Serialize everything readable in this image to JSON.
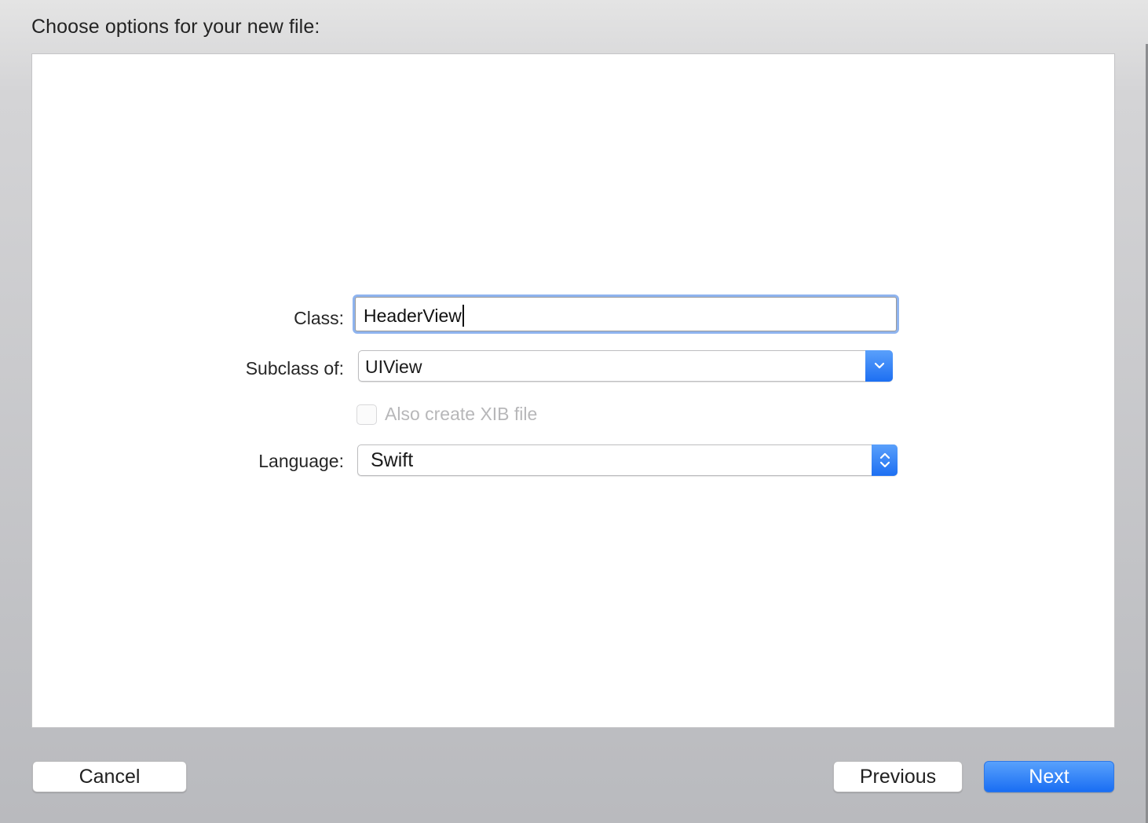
{
  "dialog": {
    "title": "Choose options for your new file:"
  },
  "form": {
    "class_label": "Class:",
    "class_value": "HeaderView",
    "subclass_label": "Subclass of:",
    "subclass_value": "UIView",
    "xib_checkbox_label": "Also create XIB file",
    "xib_checkbox_checked": false,
    "xib_checkbox_enabled": false,
    "language_label": "Language:",
    "language_value": "Swift"
  },
  "buttons": {
    "cancel": "Cancel",
    "previous": "Previous",
    "next": "Next"
  },
  "icons": {
    "subclass_popup": "chevron-down-icon",
    "language_popup": "up-down-chevron-icon"
  },
  "colors": {
    "accent": "#1d6ff2",
    "focus_ring": "#8fb4ef",
    "disabled_text": "#b7b7b9"
  }
}
